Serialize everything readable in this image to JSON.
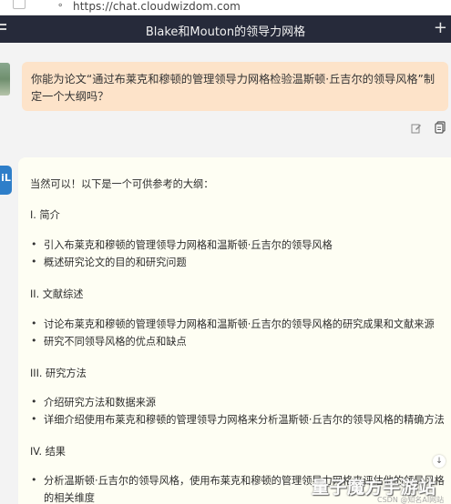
{
  "browser": {
    "url": "https://chat.cloudwizdom.com"
  },
  "header": {
    "title": "Blake和Mouton的领导力网格",
    "add_label": "+"
  },
  "question": {
    "text": "你能为论文“通过布莱克和穆顿的管理领导力网格检验温斯顿·丘吉尔的领导风格”制定一个大纲吗？"
  },
  "answer": {
    "intro": "当然可以！以下是一个可供参考的大纲：",
    "sections": [
      {
        "heading": "I. 简介",
        "items": [
          "引入布莱克和穆顿的管理领导力网格和温斯顿·丘吉尔的领导风格",
          "概述研究论文的目的和研究问题"
        ]
      },
      {
        "heading": "II. 文献综述",
        "items": [
          "讨论布莱克和穆顿的管理领导力网格和温斯顿·丘吉尔的领导风格的研究成果和文献来源",
          "研究不同领导风格的优点和缺点"
        ]
      },
      {
        "heading": "III. 研究方法",
        "items": [
          "介绍研究方法和数据来源",
          "详细介绍使用布莱克和穆顿的管理领导力网格来分析温斯顿·丘吉尔的领导风格的精确方法"
        ]
      },
      {
        "heading": "IV. 结果",
        "items": [
          "分析温斯顿·丘吉尔的领导风格，使用布莱克和穆顿的管理领导力网格来评估他的领导风格",
          "的相关维度"
        ]
      }
    ]
  },
  "watermark": {
    "main": "量子魔方手游站",
    "sub": "CSDN @知名AI网站"
  },
  "colors": {
    "titlebar_bg": "#262a3a",
    "question_bg": "#fde3c9",
    "answer_bg": "#fefef3",
    "ai_avatar": "#2e7ec9"
  }
}
